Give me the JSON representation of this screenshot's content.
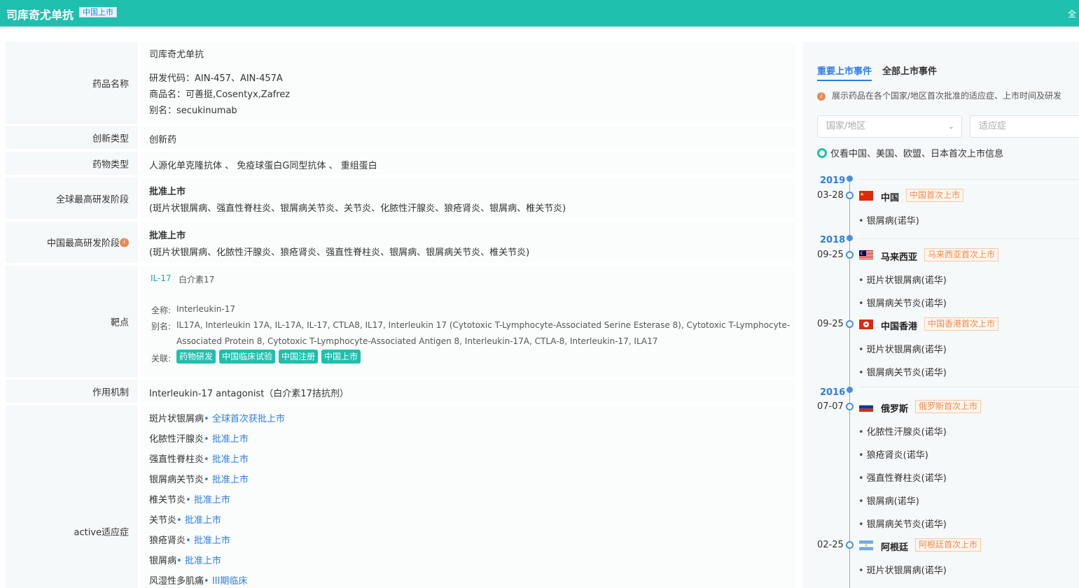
{
  "header": {
    "title": "司库奇尤单抗",
    "badge": "中国上市",
    "right_text": "全"
  },
  "labels": {
    "drug_name": "药品名称",
    "innovation": "创新类型",
    "drug_type": "药物类型",
    "global_stage": "全球最高研发阶段",
    "china_stage": "中国最高研发阶段",
    "target": "靶点",
    "mechanism": "作用机制",
    "indications": "active适应症"
  },
  "drug": {
    "name": "司库奇尤单抗",
    "codes": "研发代码：AIN-457、AIN-457A",
    "trade": "商品名：可善挺,Cosentyx,Zafrez",
    "alias": "别名：secukinumab"
  },
  "innovation_value": "创新药",
  "drug_type_value": "人源化单克隆抗体 、 免疫球蛋白G同型抗体 、 重组蛋白",
  "global_stage": {
    "status": "批准上市",
    "detail": "(斑片状银屑病、强直性脊柱炎、银屑病关节炎、关节炎、化脓性汗腺炎、狼疮肾炎、银屑病、椎关节炎)"
  },
  "china_stage": {
    "status": "批准上市",
    "detail": "(斑片状银屑病、化脓性汗腺炎、狼疮肾炎、强直性脊柱炎、银屑病、银屑病关节炎、椎关节炎)"
  },
  "target": {
    "code": "IL-17",
    "name": "白介素17",
    "full_label": "全称:",
    "full": "Interleukin-17",
    "alias_label": "别名:",
    "alias_1": "IL17A, Interleukin 17A, IL-17A, IL-17, CTLA8, IL17, Interleukin 17 (Cytotoxic T-Lymphocyte-Associated Serine Esterase 8), Cytotoxic T-Lymphocyte-",
    "alias_2": "Associated Protein 8, Cytotoxic T-Lymphocyte-Associated Antigen 8, Interleukin-17A, CTLA-8, Interleukin-17, ILA17",
    "related_label": "关联:",
    "tags": [
      "药物研发",
      "中国临床试验",
      "中国注册",
      "中国上市"
    ]
  },
  "mechanism_value": "Interleukin-17 antagonist（白介素17拮抗剂）",
  "indications": [
    {
      "name": "斑片状银屑病",
      "status": "• 全球首次获批上市"
    },
    {
      "name": "化脓性汗腺炎",
      "status": "• 批准上市"
    },
    {
      "name": "强直性脊柱炎",
      "status": "• 批准上市"
    },
    {
      "name": "银屑病关节炎",
      "status": "• 批准上市"
    },
    {
      "name": "椎关节炎",
      "status": "• 批准上市"
    },
    {
      "name": "关节炎",
      "status": "• 批准上市"
    },
    {
      "name": "狼疮肾炎",
      "status": "• 批准上市"
    },
    {
      "name": "银屑病",
      "status": "• 批准上市"
    },
    {
      "name": "风湿性多肌痛",
      "status": "• III期临床"
    }
  ],
  "panel": {
    "tab_key": "重要上市事件",
    "tab_all": "全部上市事件",
    "note": "展示药品在各个国家/地区首次批准的适应症、上市时间及研发",
    "region_placeholder": "国家/地区",
    "indication_placeholder": "适应症",
    "radio_label": "仅看中国、美国、欧盟、日本首次上市信息"
  },
  "timeline": {
    "years": [
      "2019",
      "2018",
      "2016"
    ],
    "events": [
      {
        "date": "03-28",
        "country": "中国",
        "tag": "中国首次上市",
        "inds": [
          "银屑病(诺华)"
        ]
      },
      {
        "date": "09-25",
        "country": "马来西亚",
        "tag": "马来西亚首次上市",
        "inds": [
          "斑片状银屑病(诺华)",
          "银屑病关节炎(诺华)"
        ]
      },
      {
        "date": "09-25",
        "country": "中国香港",
        "tag": "中国香港首次上市",
        "inds": [
          "斑片状银屑病(诺华)",
          "银屑病关节炎(诺华)"
        ]
      },
      {
        "date": "07-07",
        "country": "俄罗斯",
        "tag": "俄罗斯首次上市",
        "inds": [
          "化脓性汗腺炎(诺华)",
          "狼疮肾炎(诺华)",
          "强直性脊柱炎(诺华)",
          "银屑病(诺华)",
          "银屑病关节炎(诺华)"
        ]
      },
      {
        "date": "02-25",
        "country": "阿根廷",
        "tag": "阿根廷首次上市",
        "inds": [
          "斑片状银屑病(诺华)"
        ]
      }
    ]
  },
  "colors": {
    "brand": "#1fbfae",
    "link": "#2b7de9",
    "tag_orange": "#f08a4b"
  }
}
